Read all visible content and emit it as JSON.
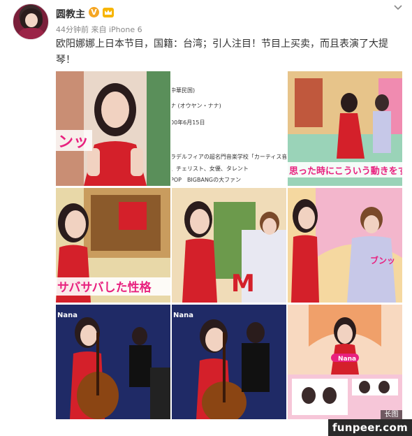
{
  "post": {
    "author": "圆教主",
    "verified_mark": "V",
    "meta": "44分钟前 来自 iPhone 6",
    "text": "欧阳娜娜上日本节目，国籍：台湾；引人注目！节目上买卖，而且表演了大提琴！"
  },
  "images": {
    "tile1": {
      "caption": "ンッ"
    },
    "tile2": {
      "lines": [
        "中華民国)",
        "ナ (オウヤン・ナナ)",
        "00年6月15日",
        "ラデルフィアの超名門音楽学校「カーティス音楽",
        "、チェリスト、女優、タレント",
        "POP　BIGBANGの大ファン"
      ]
    },
    "tile3": {
      "caption": "思った時にこういう動きをする"
    },
    "tile4": {
      "caption": "サバサバした性格"
    },
    "tile5": {
      "sign": "M"
    },
    "tile6": {
      "caption": "ブンッ"
    },
    "tile7": {
      "label": "Nana"
    },
    "tile8": {
      "label": "Nana"
    },
    "tile9": {
      "label": "Nana"
    }
  },
  "long_image_badge": "长图",
  "watermark": "funpeer.com",
  "colors": {
    "verified": "#f5a623",
    "dress_red": "#d4202a",
    "curtain_blue": "#1f2a66",
    "caption_pink": "#e8217f"
  },
  "icons": [
    "verified-badge-icon",
    "vip-crown-icon",
    "chevron-down-icon"
  ]
}
